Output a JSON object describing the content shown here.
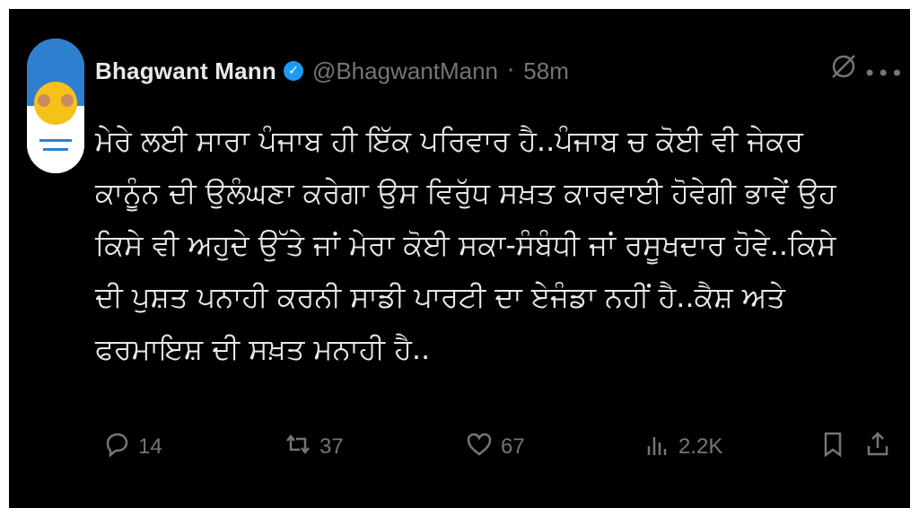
{
  "tweet": {
    "author_name": "Bhagwant Mann",
    "author_handle": "@BhagwantMann",
    "separator": "·",
    "time_ago": "58m",
    "text": "ਮੇਰੇ ਲਈ ਸਾਰਾ ਪੰਜਾਬ ਹੀ ਇੱਕ ਪਰਿਵਾਰ ਹੈ..ਪੰਜਾਬ ਚ ਕੋਈ ਵੀ ਜੇਕਰ ਕਾਨੂੰਨ ਦੀ ਉਲੰਘਣਾ ਕਰੇਗਾ ਉਸ ਵਿਰੁੱਧ ਸਖ਼ਤ ਕਾਰਵਾਈ ਹੋਵੇਗੀ ਭਾਵੇਂ ਉਹ ਕਿਸੇ ਵੀ ਅਹੁਦੇ ਉੱਤੇ ਜਾਂ ਮੇਰਾ ਕੋਈ ਸਕਾ-ਸੰਬੰਧੀ ਜਾਂ ਰਸੂਖਦਾਰ ਹੋਵੇ..ਕਿਸੇ ਦੀ ਪੁਸ਼ਤ ਪਨਾਹੀ ਕਰਨੀ ਸਾਡੀ ਪਾਰਟੀ ਦਾ ਏਜੰਡਾ ਨਹੀਂ ਹੈ..ਕੈਸ਼ ਅਤੇ ਫਰਮਾਇਸ਼ ਦੀ ਸਖ਼ਤ ਮਨਾਹੀ ਹੈ.."
  },
  "actions": {
    "replies": "14",
    "retweets": "37",
    "likes": "67",
    "views": "2.2K"
  },
  "icons": {
    "more": "more-icon",
    "grok": "grok-icon",
    "reply": "reply-icon",
    "retweet": "retweet-icon",
    "like": "like-icon",
    "views": "views-icon",
    "bookmark": "bookmark-icon",
    "share": "share-icon"
  },
  "colors": {
    "background": "#000000",
    "text": "#e7e9ea",
    "muted": "#71767b",
    "verified": "#1d9bf0"
  }
}
